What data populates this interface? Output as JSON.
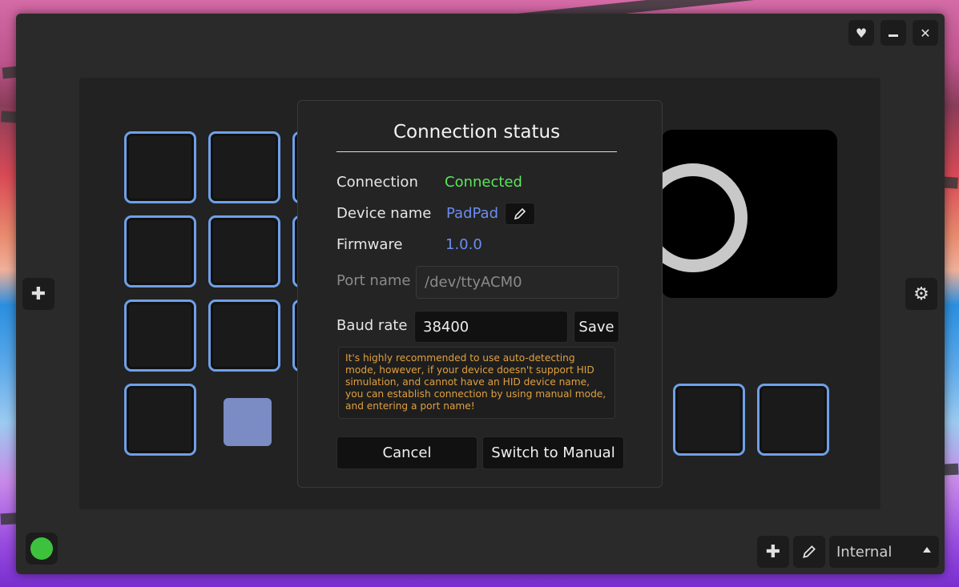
{
  "titlebar": {
    "heart_icon": "heart-icon",
    "minimize_icon": "minimize-icon",
    "close_icon": "close-icon"
  },
  "side": {
    "add_icon": "plus-icon",
    "settings_icon": "gear-icon"
  },
  "colors": {
    "key_border": "#6fa0e8",
    "connected": "#5ce65c",
    "link": "#6b8df0",
    "warning": "#e0a040",
    "swatch": "#7b8cc4",
    "status_dot": "#3ec23e"
  },
  "dialog": {
    "title": "Connection status",
    "connection_label": "Connection",
    "connection_value": "Connected",
    "device_label": "Device name",
    "device_value": "PadPad",
    "firmware_label": "Firmware",
    "firmware_value": "1.0.0",
    "port_label": "Port name",
    "port_value": "/dev/ttyACM0",
    "baud_label": "Baud rate",
    "baud_value": "38400",
    "save_label": "Save",
    "notice": "It's highly recommended to use auto-detecting mode, however, if your device doesn't support HID simulation, and cannot have an HID device name, you can establish connection by using manual mode, and entering a port name!",
    "cancel_label": "Cancel",
    "manual_label": "Switch to Manual"
  },
  "bottom": {
    "profile_value": "Internal"
  }
}
